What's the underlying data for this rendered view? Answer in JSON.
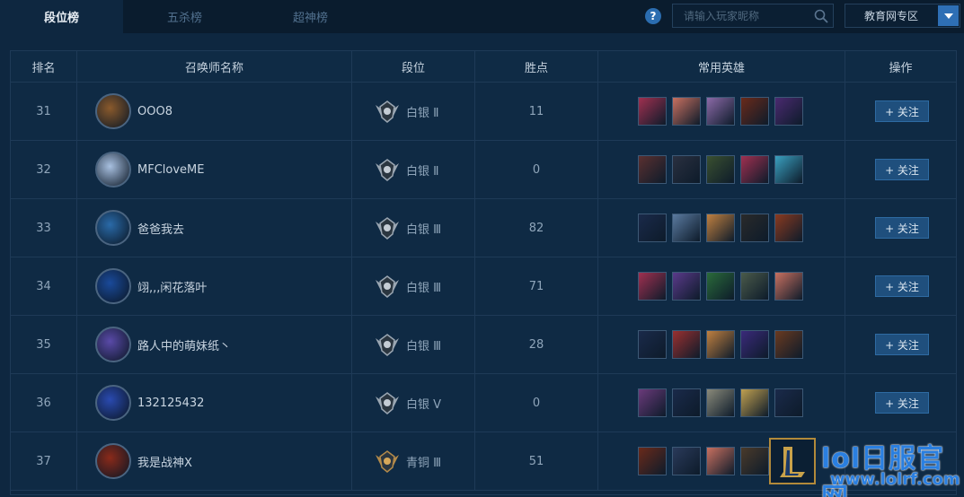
{
  "tabs": [
    {
      "label": "段位榜",
      "active": true
    },
    {
      "label": "五杀榜",
      "active": false
    },
    {
      "label": "超神榜",
      "active": false
    }
  ],
  "help_icon": "?",
  "search": {
    "placeholder": "请输入玩家昵称"
  },
  "region": {
    "selected": "教育网专区"
  },
  "columns": [
    "排名",
    "召唤师名称",
    "段位",
    "胜点",
    "常用英雄",
    "操作"
  ],
  "follow_label": "+ 关注",
  "rows": [
    {
      "rank": "31",
      "name": "OOO8",
      "tier": "白银 Ⅱ",
      "tier_color": "silver",
      "points": "11",
      "follow": true,
      "avatar": "#8a5a2c",
      "heroes": [
        "#a03050",
        "#c87060",
        "#8c6aa8",
        "#6a2a1a",
        "#4a2a70"
      ]
    },
    {
      "rank": "32",
      "name": "MFCloveME",
      "tier": "白银 Ⅱ",
      "tier_color": "silver",
      "points": "0",
      "follow": true,
      "avatar": "#a8c0e0",
      "heroes": [
        "#5a3030",
        "#2a3040",
        "#3a5030",
        "#a03050",
        "#3aa0c0"
      ]
    },
    {
      "rank": "33",
      "name": "爸爸我去",
      "tier": "白银 Ⅲ",
      "tier_color": "silver",
      "points": "82",
      "follow": true,
      "avatar": "#2a6aa8",
      "heroes": [
        "#1a2a4a",
        "#5a7aa0",
        "#c08040",
        "#2a2a2a",
        "#8a3a20"
      ]
    },
    {
      "rank": "34",
      "name": "翊,,,闲花落叶",
      "tier": "白银 Ⅲ",
      "tier_color": "silver",
      "points": "71",
      "follow": true,
      "avatar": "#1a4a9a",
      "heroes": [
        "#a03050",
        "#5a3a8a",
        "#2a6a3a",
        "#4a5a4a",
        "#c87060"
      ]
    },
    {
      "rank": "35",
      "name": "路人中的萌妹纸丶",
      "tier": "白银 Ⅲ",
      "tier_color": "silver",
      "points": "28",
      "follow": true,
      "avatar": "#5a4aa8",
      "heroes": [
        "#1a2a4a",
        "#9a3030",
        "#c08040",
        "#3a2a7a",
        "#6a3a20"
      ]
    },
    {
      "rank": "36",
      "name": "132125432",
      "tier": "白银 Ⅴ",
      "tier_color": "silver",
      "points": "0",
      "follow": true,
      "avatar": "#2a4ab0",
      "heroes": [
        "#6a3a7a",
        "#1a2a4a",
        "#8a8a7a",
        "#c0a050",
        "#1a2a4a"
      ]
    },
    {
      "rank": "37",
      "name": "我是战神X",
      "tier": "青铜 Ⅲ",
      "tier_color": "bronze",
      "points": "51",
      "follow": false,
      "avatar": "#8a2a1a",
      "heroes": [
        "#6a2a1a",
        "#2a3a5a",
        "#c87060",
        "#4a3a2a",
        "#5a2a1a"
      ]
    }
  ],
  "watermark": {
    "line1": "lol日服官网",
    "line2": "www.lolrf.com"
  }
}
